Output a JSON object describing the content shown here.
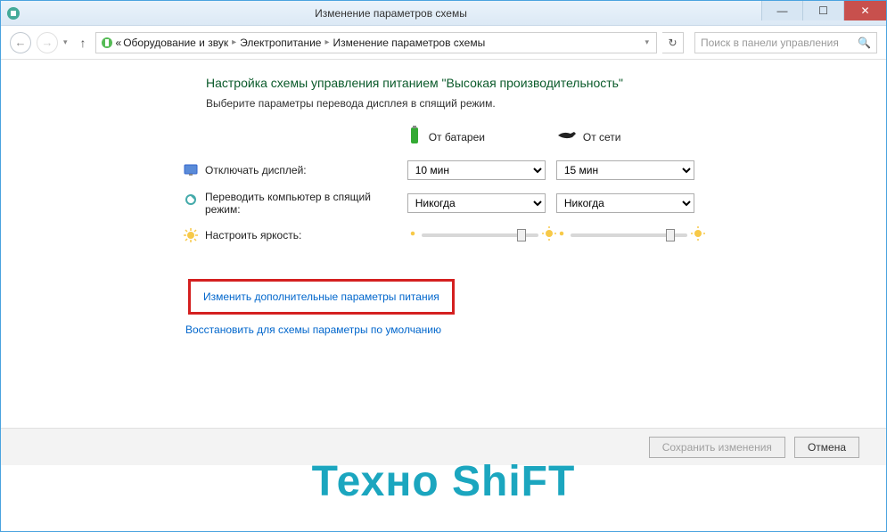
{
  "window": {
    "title": "Изменение параметров схемы"
  },
  "breadcrumb": {
    "leading": "«",
    "items": [
      "Оборудование и звук",
      "Электропитание",
      "Изменение параметров схемы"
    ]
  },
  "search": {
    "placeholder": "Поиск в панели управления"
  },
  "page": {
    "heading": "Настройка схемы управления питанием \"Высокая производительность\"",
    "subtext": "Выберите параметры перевода дисплея в спящий режим."
  },
  "columns": {
    "battery": "От батареи",
    "ac": "От сети"
  },
  "rows": {
    "display_off": {
      "label": "Отключать дисплей:",
      "battery_value": "10 мин",
      "ac_value": "15 мин"
    },
    "sleep": {
      "label": "Переводить компьютер в спящий режим:",
      "battery_value": "Никогда",
      "ac_value": "Никогда"
    },
    "brightness": {
      "label": "Настроить яркость:",
      "battery_pct": 82,
      "ac_pct": 82
    }
  },
  "links": {
    "advanced": "Изменить дополнительные параметры питания",
    "restore": "Восстановить для схемы параметры по умолчанию"
  },
  "buttons": {
    "save": "Сохранить изменения",
    "cancel": "Отмена"
  },
  "watermark": "Техно ShiFT"
}
